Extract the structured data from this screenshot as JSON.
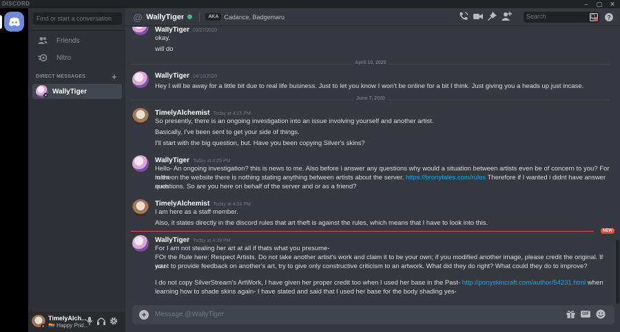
{
  "window": {
    "brand": "DISCORD",
    "controls": [
      "–",
      "▢",
      "✕"
    ]
  },
  "sidebar": {
    "search_placeholder": "Find or start a conversation",
    "friends_label": "Friends",
    "nitro_label": "Nitro",
    "dm_header": "DIRECT MESSAGES",
    "dm_add": "+",
    "dms": [
      {
        "name": "WallyTiger",
        "status": "online"
      }
    ]
  },
  "user_panel": {
    "name": "TimelyAlch...",
    "status": "🏳️‍🌈 Happy Prid..."
  },
  "header": {
    "at": "@",
    "name": "WallyTiger",
    "aka_badge": "AKA",
    "nicknames": "Cadance, Badgemaru",
    "search_placeholder": "Search",
    "help": "?"
  },
  "messages": [
    {
      "author": "WallyTiger",
      "timestamp": "03/27/2020",
      "lines": [
        "okay.",
        "will do"
      ]
    },
    {
      "divider": "April 10, 2020"
    },
    {
      "author": "WallyTiger",
      "timestamp": "04/10/2020",
      "lines": [
        "Hey I will be away for a little bit due to real life business. Just to let you know I won't be online for a bit I think. Just giving you a heads up just incase."
      ]
    },
    {
      "divider": "June 7, 2020"
    },
    {
      "author": "TimelyAlchemist",
      "timestamp": "Today at 4:15 PM",
      "lines": [
        "So presently, there is an ongoing investigation into an issue involving yourself and another artist.",
        "Basically, I've been sent to get your side of things.",
        "I'll start with the big question, but. Have you been copying Silver's skins?"
      ]
    },
    {
      "author": "WallyTiger",
      "timestamp": "Today at 4:25 PM",
      "lines": [
        "Hello- An ongoing investigation? this is news to me. Also before i answer any questions why would a situation between artists even be of concern to you? For in the",
        "rules on the website there is nothing stating anything between artists about the server.",
        "https://bronytales.com/rules",
        "Therefore if I wanted i didnt have answer such",
        "questions. So are you here on behalf of the server and or as a friend?"
      ]
    },
    {
      "author": "TimelyAlchemist",
      "timestamp": "Today at 4:34 PM",
      "lines": [
        "I am here as a staff member.",
        "Also, it states directly in the discord rules that art theft is against the rules, which means that I have to look into this."
      ]
    },
    {
      "new_badge": "NEW"
    },
    {
      "author": "WallyTiger",
      "timestamp": "Today at 4:39 PM",
      "lines": [
        "For I am not stealing her art at all if thats what you presume-",
        "FOr the Rule here: Respect Artists. Do not take another artist's work and claim it to be your own; if you modified another image, please credit the original. If you",
        "want to provide feedback on another's art, try to give only constructive criticism to an artwork. What did they do right? What could they do to improve?",
        "I do not copy SilverStream's ArtWork, I have given her proper credit too when I used her base in the Past-",
        "http://ponyskincraft.com/author/54231.html",
        "when",
        "learning how to shade skins again- I have stated and said that I used her base for the body shading yes-"
      ]
    }
  ],
  "composer": {
    "placeholder": "Message @WallyTiger",
    "gif_label": "GIF"
  },
  "colors": {
    "blurple": "#7289da",
    "online": "#43b581",
    "link": "#00b0f4",
    "new": "#f04747"
  }
}
